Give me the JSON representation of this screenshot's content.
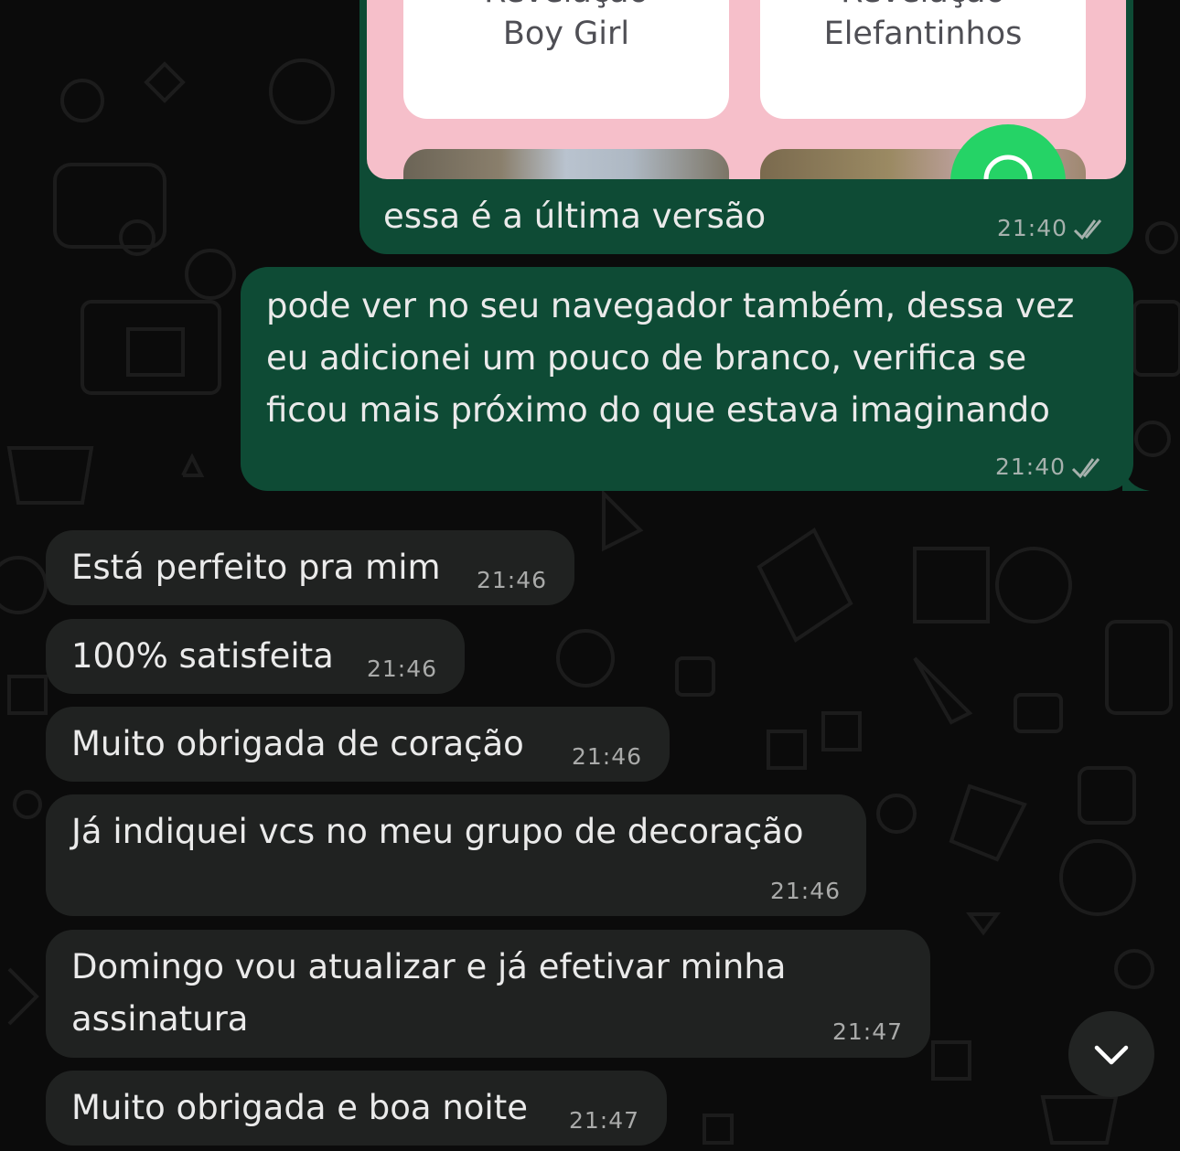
{
  "preview": {
    "cards": [
      {
        "line1": "Revelação",
        "line2": "Boy Girl"
      },
      {
        "line1": "Revelação",
        "line2": "Elefantinhos"
      }
    ],
    "caption": "essa é a última versão",
    "time": "21:40"
  },
  "messages_out": [
    {
      "lines": [
        "pode ver no seu navegador também, dessa vez",
        "eu adicionei um pouco de branco, verifica se",
        "ficou mais próximo do que estava imaginando"
      ],
      "time": "21:40"
    }
  ],
  "messages_in": [
    {
      "lines": [
        "Está perfeito pra mim"
      ],
      "time": "21:46"
    },
    {
      "lines": [
        "100% satisfeita"
      ],
      "time": "21:46"
    },
    {
      "lines": [
        "Muito obrigada de coração"
      ],
      "time": "21:46"
    },
    {
      "lines": [
        "Já indiquei vcs no meu grupo de decoração"
      ],
      "time": "21:46"
    },
    {
      "lines": [
        "Domingo vou atualizar e já efetivar minha",
        "assinatura"
      ],
      "time": "21:47"
    },
    {
      "lines": [
        "Muito obrigada e boa noite"
      ],
      "time": "21:47"
    }
  ],
  "icons": {
    "read_receipt": "double-check-icon",
    "scroll_down": "chevron-down-icon",
    "whatsapp": "whatsapp-icon"
  },
  "colors": {
    "outgoing_bubble": "#0e4b35",
    "incoming_bubble": "#202221",
    "background": "#0b0b0b",
    "preview_bg": "#f6bfca",
    "whatsapp_green": "#25d366"
  }
}
